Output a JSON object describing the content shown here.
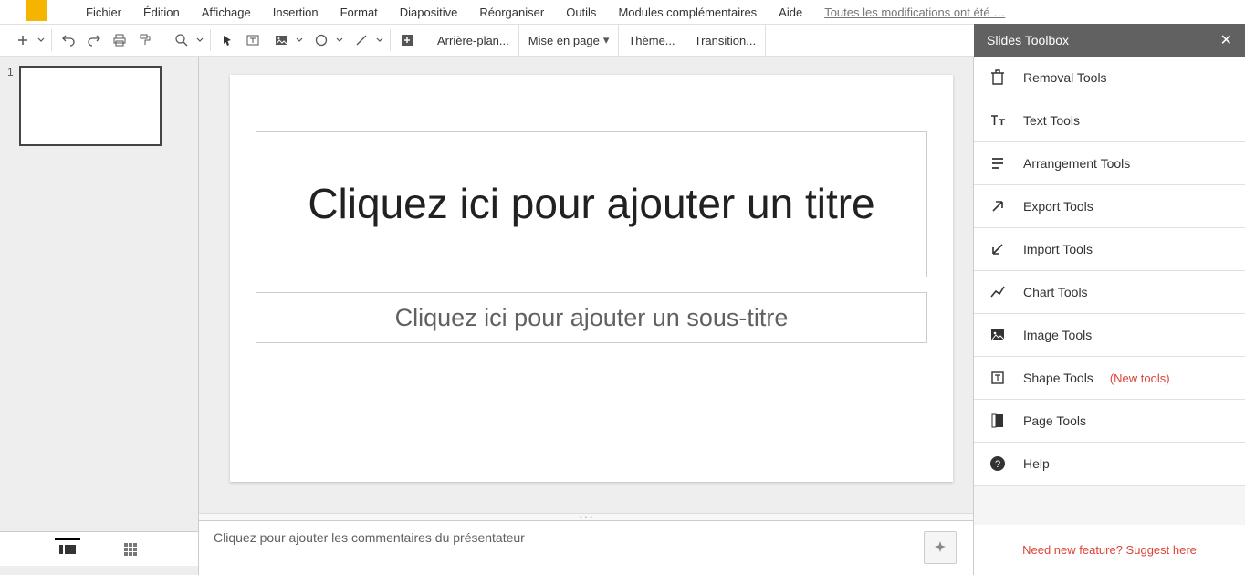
{
  "menubar": {
    "items": [
      "Fichier",
      "Édition",
      "Affichage",
      "Insertion",
      "Format",
      "Diapositive",
      "Réorganiser",
      "Outils",
      "Modules complémentaires",
      "Aide"
    ],
    "mods_saved": "Toutes les modifications ont été …"
  },
  "toolbar": {
    "background": "Arrière-plan...",
    "layout": "Mise en page",
    "theme": "Thème...",
    "transition": "Transition..."
  },
  "filmstrip": {
    "slide_number": "1"
  },
  "slide": {
    "title_placeholder": "Cliquez ici pour ajouter un titre",
    "subtitle_placeholder": "Cliquez ici pour ajouter un sous-titre"
  },
  "speaker_notes": {
    "placeholder": "Cliquez pour ajouter les commentaires du présentateur"
  },
  "sidebar": {
    "title": "Slides Toolbox",
    "items": [
      {
        "label": "Removal Tools"
      },
      {
        "label": "Text Tools"
      },
      {
        "label": "Arrangement Tools"
      },
      {
        "label": "Export Tools"
      },
      {
        "label": "Import Tools"
      },
      {
        "label": "Chart Tools"
      },
      {
        "label": "Image Tools"
      },
      {
        "label": "Shape Tools",
        "badge": "(New tools)"
      },
      {
        "label": "Page Tools"
      },
      {
        "label": "Help"
      }
    ],
    "footer_link": "Need new feature? Suggest here"
  }
}
